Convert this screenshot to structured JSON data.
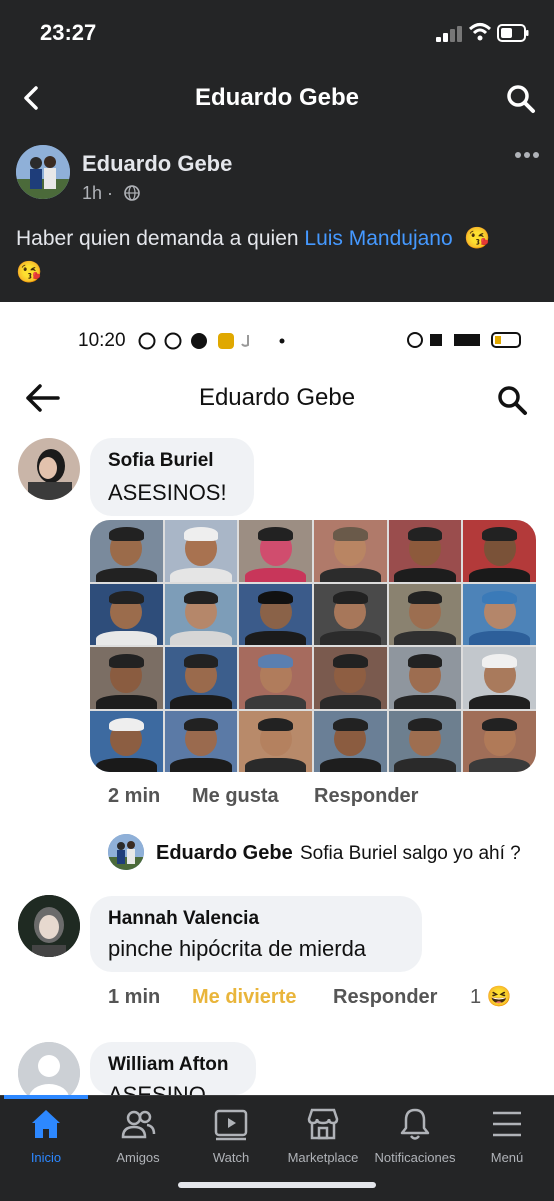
{
  "status_bar": {
    "time": "23:27"
  },
  "nav": {
    "title": "Eduardo Gebe"
  },
  "post": {
    "author": "Eduardo Gebe",
    "time": "1h",
    "separator": "·",
    "text_prefix": "Haber quien demanda a quien",
    "mention": "Luis Mandujano",
    "emoji_1": "😘",
    "emoji_2": "😘"
  },
  "screenshot": {
    "status_time": "10:20",
    "title": "Eduardo Gebe",
    "comments": [
      {
        "name": "Sofia Buriel",
        "text": "ASESINOS!",
        "time": "2 min",
        "like": "Me gusta",
        "reply": "Responder",
        "reply_thread": {
          "name": "Eduardo Gebe",
          "text": "Sofia Buriel salgo yo ahí ?"
        }
      },
      {
        "name": "Hannah Valencia",
        "text": "pinche hipócrita de mierda",
        "time": "1 min",
        "reaction_label": "Me divierte",
        "reply": "Responder",
        "reaction_count": "1",
        "reaction_emoji": "😆"
      },
      {
        "name": "William Afton",
        "text": "ASESINO..."
      }
    ]
  },
  "tabs": [
    {
      "label": "Inicio",
      "icon": "home-icon",
      "active": true
    },
    {
      "label": "Amigos",
      "icon": "friends-icon"
    },
    {
      "label": "Watch",
      "icon": "watch-icon"
    },
    {
      "label": "Marketplace",
      "icon": "marketplace-icon"
    },
    {
      "label": "Notificaciones",
      "icon": "bell-icon"
    },
    {
      "label": "Menú",
      "icon": "menu-icon"
    }
  ],
  "colors": {
    "accent": "#2d88ff",
    "mention": "#4599ff",
    "reaction": "#e9b53b",
    "background": "#242526"
  }
}
